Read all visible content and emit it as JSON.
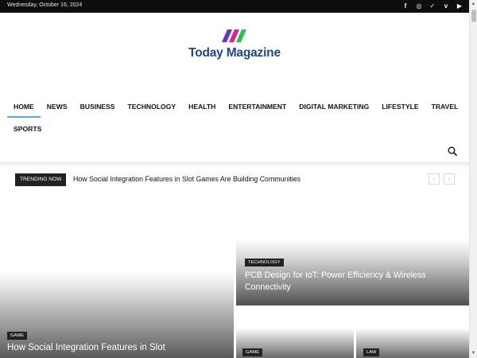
{
  "topbar": {
    "date": "Wednesday, October 16, 2024",
    "social": [
      {
        "icon": "facebook-icon",
        "glyph": "f"
      },
      {
        "icon": "instagram-icon",
        "glyph": "◎"
      },
      {
        "icon": "twitter-icon",
        "glyph": "✓"
      },
      {
        "icon": "vimeo-icon",
        "glyph": "v"
      },
      {
        "icon": "youtube-icon",
        "glyph": "▶"
      }
    ]
  },
  "logo": {
    "name": "Today Magazine",
    "colors": [
      "#6b2fd6",
      "#e0218a",
      "#2fbf4a"
    ]
  },
  "nav": {
    "items": [
      "HOME",
      "NEWS",
      "BUSINESS",
      "TECHNOLOGY",
      "HEALTH",
      "ENTERTAINMENT",
      "DIGITAL MARKETING",
      "LIFESTYLE",
      "TRAVEL"
    ],
    "items_row2": [
      "SPORTS"
    ],
    "active": "HOME",
    "accent": "#4db2ec"
  },
  "trending": {
    "badge": "TRENDING NOW",
    "title": "How Social Integration Features in Slot Games Are Building Communities",
    "prev": "‹",
    "next": "›"
  },
  "cards": {
    "big": {
      "category": "GAME",
      "title": "How Social Integration Features in Slot"
    },
    "top_right": {
      "category": "TECHNOLOGY",
      "title": "PCB Design for IoT: Power Efficiency & Wireless Connectivity"
    },
    "bottom_left": {
      "category": "GAME"
    },
    "bottom_right": {
      "category": "LAW"
    }
  },
  "scrollbar": {
    "up": "▲",
    "down": "▼"
  }
}
